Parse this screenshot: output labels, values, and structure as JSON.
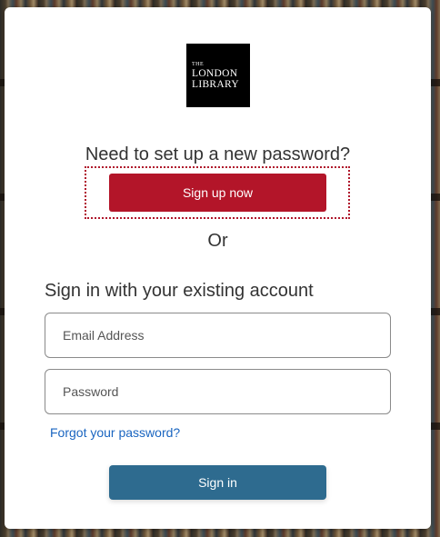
{
  "logo": {
    "line1": "THE",
    "line2": "LONDON",
    "line3": "LIBRARY"
  },
  "signup": {
    "headline": "Need to set up a new password?",
    "button_label": "Sign up now",
    "button_color": "#b31529"
  },
  "divider_text": "Or",
  "signin": {
    "heading": "Sign in with your existing account",
    "email_placeholder": "Email Address",
    "password_placeholder": "Password",
    "forgot_link": "Forgot your password?",
    "button_label": "Sign in",
    "button_color": "#2e6b8f",
    "link_color": "#1a65c0"
  }
}
